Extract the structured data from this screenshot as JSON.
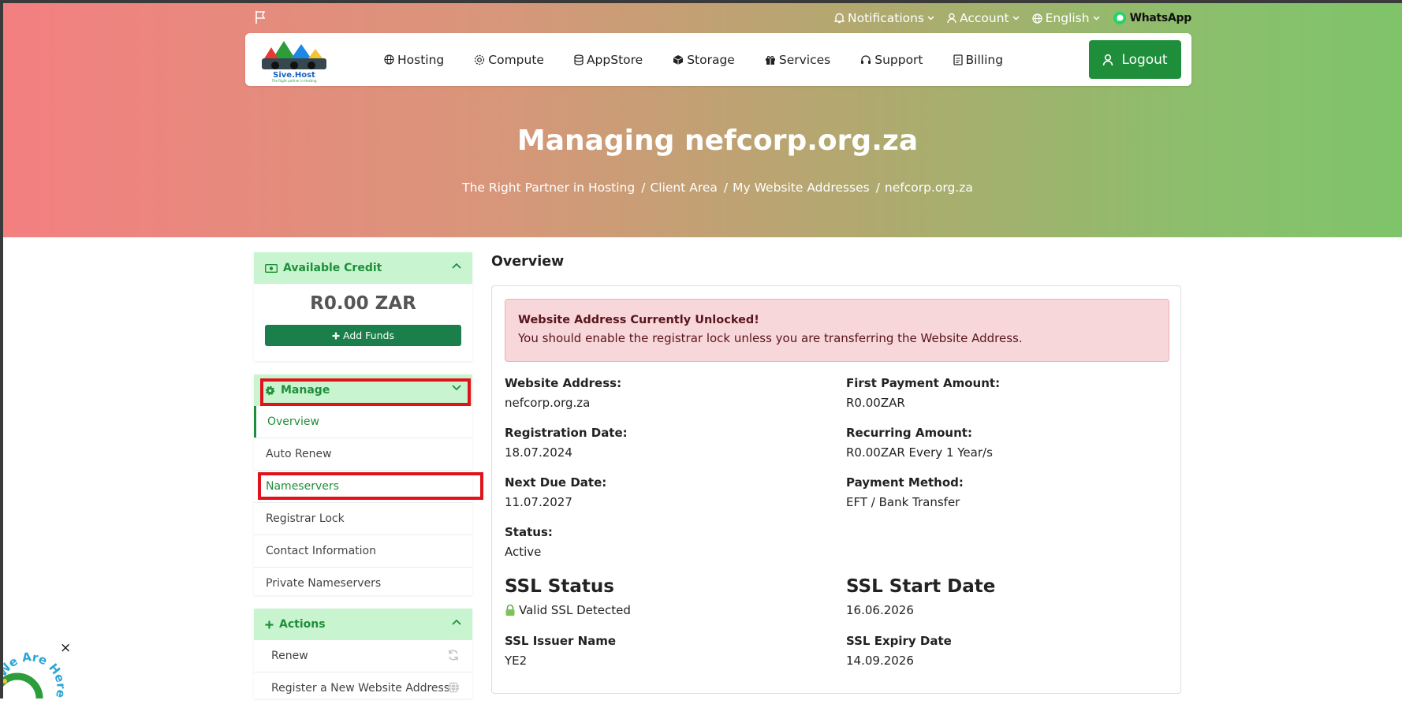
{
  "topbar": {
    "notifications": "Notifications",
    "account": "Account",
    "language": "English",
    "whatsapp": "WhatsApp"
  },
  "logo": {
    "name": "Sive.Host",
    "tagline": "The Right partner in Hosting"
  },
  "nav": {
    "hosting": "Hosting",
    "compute": "Compute",
    "appstore": "AppStore",
    "storage": "Storage",
    "services": "Services",
    "support": "Support",
    "billing": "Billing",
    "logout": "Logout"
  },
  "hero": {
    "title": "Managing nefcorp.org.za",
    "breadcrumb": [
      "The Right Partner in Hosting",
      "Client Area",
      "My Website Addresses",
      "nefcorp.org.za"
    ]
  },
  "sidebar": {
    "credit": {
      "title": "Available Credit",
      "amount": "R0.00 ZAR",
      "add_funds": "Add Funds"
    },
    "manage": {
      "title": "Manage",
      "items": [
        "Overview",
        "Auto Renew",
        "Nameservers",
        "Registrar Lock",
        "Contact Information",
        "Private Nameservers"
      ]
    },
    "actions": {
      "title": "Actions",
      "items": [
        "Renew",
        "Register a New Website Address"
      ]
    }
  },
  "main": {
    "title": "Overview",
    "alert": {
      "title": "Website Address Currently Unlocked!",
      "message": "You should enable the registrar lock unless you are transferring the Website Address."
    },
    "fields": {
      "website_address": {
        "label": "Website Address:",
        "value": "nefcorp.org.za"
      },
      "first_payment": {
        "label": "First Payment Amount:",
        "value": "R0.00ZAR"
      },
      "registration_date": {
        "label": "Registration Date:",
        "value": "18.07.2024"
      },
      "recurring_amount": {
        "label": "Recurring Amount:",
        "value": "R0.00ZAR Every 1 Year/s"
      },
      "next_due_date": {
        "label": "Next Due Date:",
        "value": "11.07.2027"
      },
      "payment_method": {
        "label": "Payment Method:",
        "value": "EFT / Bank Transfer"
      },
      "status": {
        "label": "Status:",
        "value": "Active"
      }
    },
    "ssl": {
      "status_title": "SSL Status",
      "status_value": "Valid SSL Detected",
      "start_title": "SSL Start Date",
      "start_value": "16.06.2026",
      "issuer_label": "SSL Issuer Name",
      "issuer_value": "YE2",
      "expiry_label": "SSL Expiry Date",
      "expiry_value": "14.09.2026"
    }
  },
  "widget": {
    "text": "We Are Here",
    "close": "×"
  },
  "colors": {
    "brand_green": "#1f8e3a",
    "alert_bg": "#f8d7da",
    "highlight_red": "#e0121b"
  }
}
